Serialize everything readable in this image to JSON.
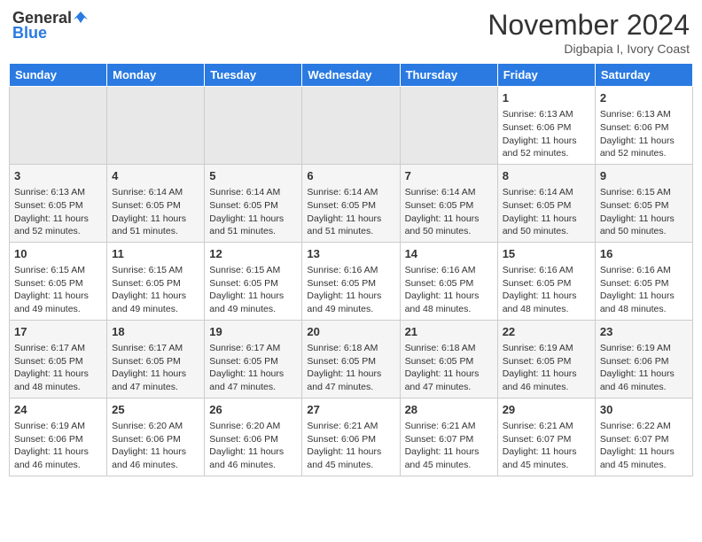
{
  "header": {
    "logo_general": "General",
    "logo_blue": "Blue",
    "month": "November 2024",
    "location": "Digbapia I, Ivory Coast"
  },
  "weekdays": [
    "Sunday",
    "Monday",
    "Tuesday",
    "Wednesday",
    "Thursday",
    "Friday",
    "Saturday"
  ],
  "weeks": [
    [
      {
        "day": "",
        "empty": true
      },
      {
        "day": "",
        "empty": true
      },
      {
        "day": "",
        "empty": true
      },
      {
        "day": "",
        "empty": true
      },
      {
        "day": "",
        "empty": true
      },
      {
        "day": "1",
        "sunrise": "Sunrise: 6:13 AM",
        "sunset": "Sunset: 6:06 PM",
        "daylight": "Daylight: 11 hours and 52 minutes."
      },
      {
        "day": "2",
        "sunrise": "Sunrise: 6:13 AM",
        "sunset": "Sunset: 6:06 PM",
        "daylight": "Daylight: 11 hours and 52 minutes."
      }
    ],
    [
      {
        "day": "3",
        "sunrise": "Sunrise: 6:13 AM",
        "sunset": "Sunset: 6:05 PM",
        "daylight": "Daylight: 11 hours and 52 minutes."
      },
      {
        "day": "4",
        "sunrise": "Sunrise: 6:14 AM",
        "sunset": "Sunset: 6:05 PM",
        "daylight": "Daylight: 11 hours and 51 minutes."
      },
      {
        "day": "5",
        "sunrise": "Sunrise: 6:14 AM",
        "sunset": "Sunset: 6:05 PM",
        "daylight": "Daylight: 11 hours and 51 minutes."
      },
      {
        "day": "6",
        "sunrise": "Sunrise: 6:14 AM",
        "sunset": "Sunset: 6:05 PM",
        "daylight": "Daylight: 11 hours and 51 minutes."
      },
      {
        "day": "7",
        "sunrise": "Sunrise: 6:14 AM",
        "sunset": "Sunset: 6:05 PM",
        "daylight": "Daylight: 11 hours and 50 minutes."
      },
      {
        "day": "8",
        "sunrise": "Sunrise: 6:14 AM",
        "sunset": "Sunset: 6:05 PM",
        "daylight": "Daylight: 11 hours and 50 minutes."
      },
      {
        "day": "9",
        "sunrise": "Sunrise: 6:15 AM",
        "sunset": "Sunset: 6:05 PM",
        "daylight": "Daylight: 11 hours and 50 minutes."
      }
    ],
    [
      {
        "day": "10",
        "sunrise": "Sunrise: 6:15 AM",
        "sunset": "Sunset: 6:05 PM",
        "daylight": "Daylight: 11 hours and 49 minutes."
      },
      {
        "day": "11",
        "sunrise": "Sunrise: 6:15 AM",
        "sunset": "Sunset: 6:05 PM",
        "daylight": "Daylight: 11 hours and 49 minutes."
      },
      {
        "day": "12",
        "sunrise": "Sunrise: 6:15 AM",
        "sunset": "Sunset: 6:05 PM",
        "daylight": "Daylight: 11 hours and 49 minutes."
      },
      {
        "day": "13",
        "sunrise": "Sunrise: 6:16 AM",
        "sunset": "Sunset: 6:05 PM",
        "daylight": "Daylight: 11 hours and 49 minutes."
      },
      {
        "day": "14",
        "sunrise": "Sunrise: 6:16 AM",
        "sunset": "Sunset: 6:05 PM",
        "daylight": "Daylight: 11 hours and 48 minutes."
      },
      {
        "day": "15",
        "sunrise": "Sunrise: 6:16 AM",
        "sunset": "Sunset: 6:05 PM",
        "daylight": "Daylight: 11 hours and 48 minutes."
      },
      {
        "day": "16",
        "sunrise": "Sunrise: 6:16 AM",
        "sunset": "Sunset: 6:05 PM",
        "daylight": "Daylight: 11 hours and 48 minutes."
      }
    ],
    [
      {
        "day": "17",
        "sunrise": "Sunrise: 6:17 AM",
        "sunset": "Sunset: 6:05 PM",
        "daylight": "Daylight: 11 hours and 48 minutes."
      },
      {
        "day": "18",
        "sunrise": "Sunrise: 6:17 AM",
        "sunset": "Sunset: 6:05 PM",
        "daylight": "Daylight: 11 hours and 47 minutes."
      },
      {
        "day": "19",
        "sunrise": "Sunrise: 6:17 AM",
        "sunset": "Sunset: 6:05 PM",
        "daylight": "Daylight: 11 hours and 47 minutes."
      },
      {
        "day": "20",
        "sunrise": "Sunrise: 6:18 AM",
        "sunset": "Sunset: 6:05 PM",
        "daylight": "Daylight: 11 hours and 47 minutes."
      },
      {
        "day": "21",
        "sunrise": "Sunrise: 6:18 AM",
        "sunset": "Sunset: 6:05 PM",
        "daylight": "Daylight: 11 hours and 47 minutes."
      },
      {
        "day": "22",
        "sunrise": "Sunrise: 6:19 AM",
        "sunset": "Sunset: 6:05 PM",
        "daylight": "Daylight: 11 hours and 46 minutes."
      },
      {
        "day": "23",
        "sunrise": "Sunrise: 6:19 AM",
        "sunset": "Sunset: 6:06 PM",
        "daylight": "Daylight: 11 hours and 46 minutes."
      }
    ],
    [
      {
        "day": "24",
        "sunrise": "Sunrise: 6:19 AM",
        "sunset": "Sunset: 6:06 PM",
        "daylight": "Daylight: 11 hours and 46 minutes."
      },
      {
        "day": "25",
        "sunrise": "Sunrise: 6:20 AM",
        "sunset": "Sunset: 6:06 PM",
        "daylight": "Daylight: 11 hours and 46 minutes."
      },
      {
        "day": "26",
        "sunrise": "Sunrise: 6:20 AM",
        "sunset": "Sunset: 6:06 PM",
        "daylight": "Daylight: 11 hours and 46 minutes."
      },
      {
        "day": "27",
        "sunrise": "Sunrise: 6:21 AM",
        "sunset": "Sunset: 6:06 PM",
        "daylight": "Daylight: 11 hours and 45 minutes."
      },
      {
        "day": "28",
        "sunrise": "Sunrise: 6:21 AM",
        "sunset": "Sunset: 6:07 PM",
        "daylight": "Daylight: 11 hours and 45 minutes."
      },
      {
        "day": "29",
        "sunrise": "Sunrise: 6:21 AM",
        "sunset": "Sunset: 6:07 PM",
        "daylight": "Daylight: 11 hours and 45 minutes."
      },
      {
        "day": "30",
        "sunrise": "Sunrise: 6:22 AM",
        "sunset": "Sunset: 6:07 PM",
        "daylight": "Daylight: 11 hours and 45 minutes."
      }
    ]
  ]
}
